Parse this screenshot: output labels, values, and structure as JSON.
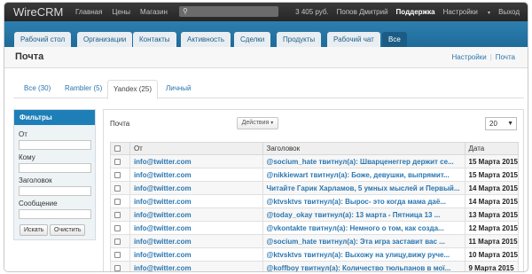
{
  "topbar": {
    "logo": "WireCRM",
    "nav": [
      "Главная",
      "Цены",
      "Магазин"
    ],
    "balance": "3 405 руб.",
    "user": "Попов Дмитрий",
    "support": "Поддержка",
    "settings": "Настройки",
    "logout": "Выход"
  },
  "modules": [
    "Рабочий стол",
    "Организации",
    "Контакты",
    "Активность",
    "Сделки",
    "Продукты",
    "Рабочий чат",
    "Все"
  ],
  "page": {
    "title": "Почта",
    "link_settings": "Настройки",
    "link_mail": "Почта"
  },
  "mail_tabs": [
    "Все (30)",
    "Rambler (5)",
    "Yandex (25)",
    "Личный"
  ],
  "filters": {
    "title": "Фильтры",
    "from_label": "От",
    "to_label": "Кому",
    "subject_label": "Заголовок",
    "message_label": "Сообщение",
    "search_button": "Искать",
    "clear_button": "Очистить"
  },
  "list": {
    "title": "Почта",
    "actions": "Действия",
    "page_size": "20",
    "columns": [
      "От",
      "Заголовок",
      "Дата"
    ],
    "rows": [
      {
        "from": "info@twitter.com",
        "subject": "@socium_hate твитнул(а): Шварценеггер держит се...",
        "date": "15 Марта 2015"
      },
      {
        "from": "info@twitter.com",
        "subject": "@nikkiewart твитнул(а): Боже, девушки, выпрямит...",
        "date": "15 Марта 2015"
      },
      {
        "from": "info@twitter.com",
        "subject": "Читайте Гарик Харламов, 5 умных мыслей и Первый...",
        "date": "14 Марта 2015"
      },
      {
        "from": "info@twitter.com",
        "subject": "@ktvsktvs твитнул(а): Вырос- это когда мама даё...",
        "date": "14 Марта 2015"
      },
      {
        "from": "info@twitter.com",
        "subject": "@today_okay твитнул(а): 13 марта - Пятница 13 ...",
        "date": "13 Марта 2015"
      },
      {
        "from": "info@twitter.com",
        "subject": "@vkontakte твитнул(а): Немного о том, как созда...",
        "date": "12 Марта 2015"
      },
      {
        "from": "info@twitter.com",
        "subject": "@socium_hate твитнул(а): Эта игра заставит вас ...",
        "date": "11 Марта 2015"
      },
      {
        "from": "info@twitter.com",
        "subject": "@ktvsktvs твитнул(а): Выхожу на улицу,вижу руче...",
        "date": "10 Марта 2015"
      },
      {
        "from": "info@twitter.com",
        "subject": "@koffboy твитнул(а): Количество тюльпанов в мої...",
        "date": "9 Марта 2015"
      }
    ]
  }
}
